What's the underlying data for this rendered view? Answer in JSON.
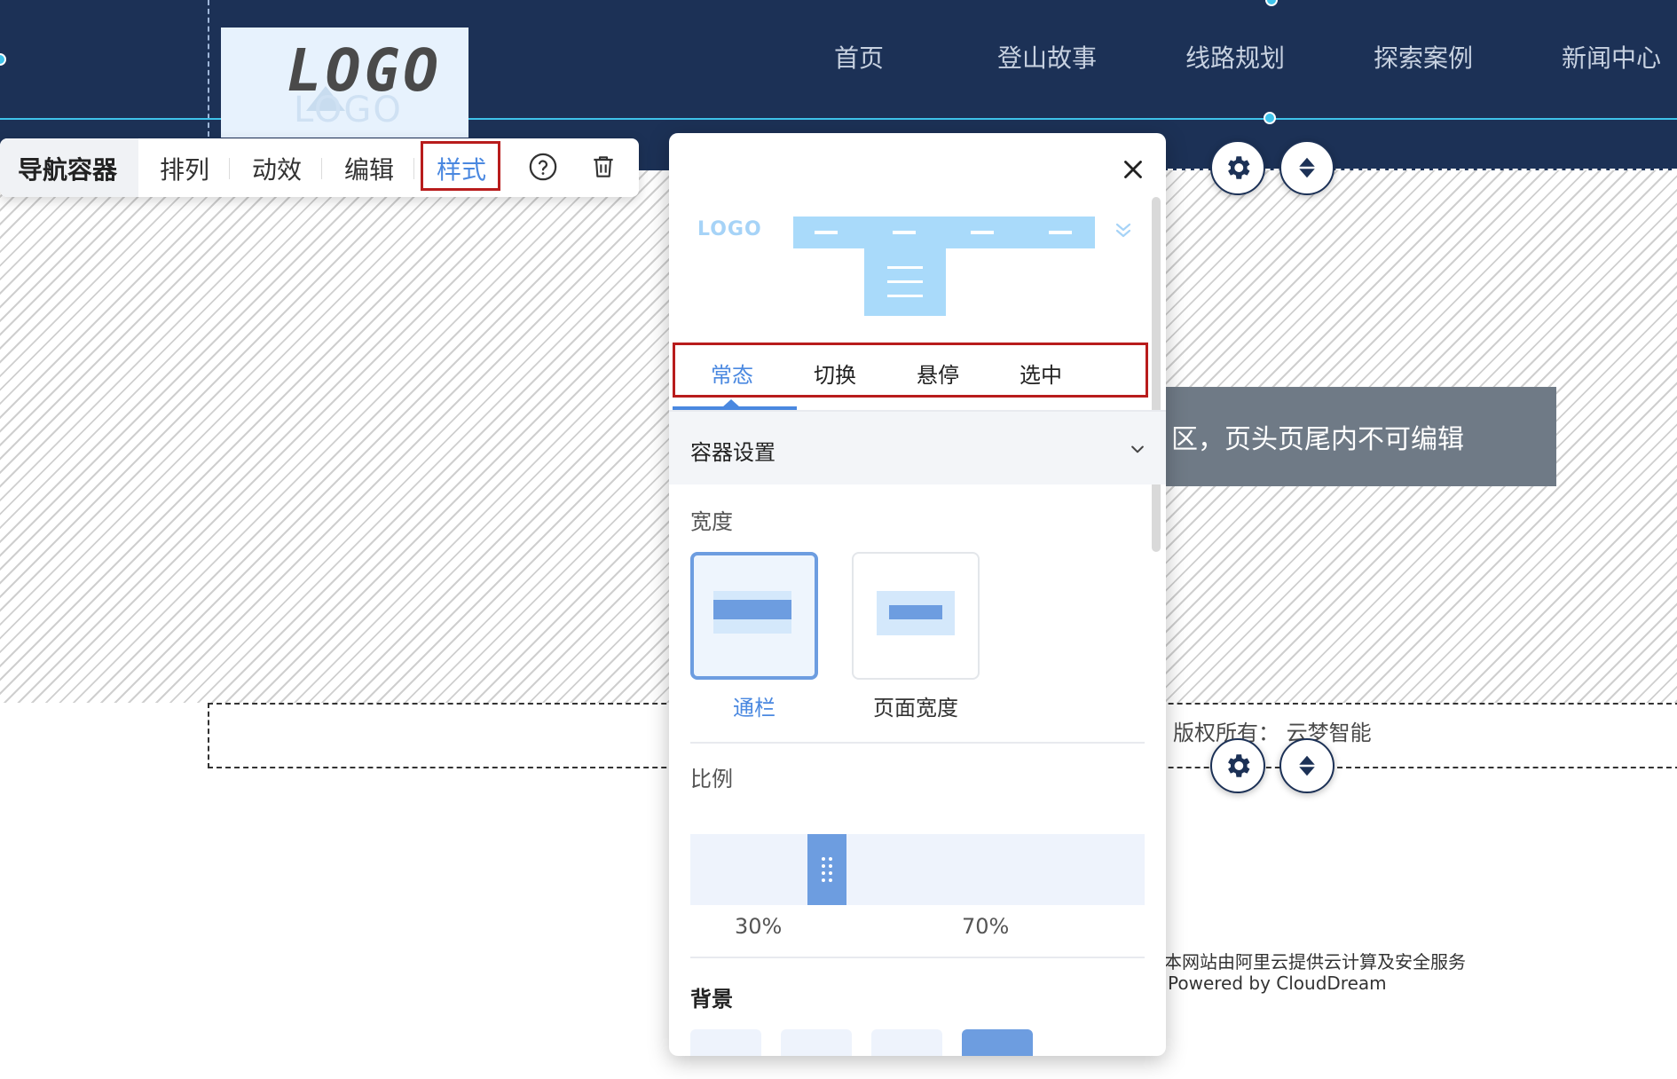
{
  "header": {
    "logo_text": "LOGO",
    "logo_ghost_text": "LOGO",
    "nav": [
      "首页",
      "登山故事",
      "线路规划",
      "探索案例",
      "新闻中心"
    ]
  },
  "canvas": {
    "notice": "区，页头页尾内不可编辑",
    "copyright": "版权所有：  云梦智能",
    "powered_cn": "本网站由阿里云提供云计算及安全服务",
    "powered_en": "Powered by CloudDream"
  },
  "controls": {
    "settings_icon": "gear-icon",
    "move_icon": "up-down-arrows-icon"
  },
  "toolbar": {
    "container_label": "导航容器",
    "arrange_label": "排列",
    "animation_label": "动效",
    "edit_label": "编辑",
    "style_label": "样式",
    "help_icon": "question-circle-icon",
    "delete_icon": "trash-icon"
  },
  "panel": {
    "close_icon": "close-icon",
    "preview": {
      "logo_text": "LOGO",
      "expand_icon": "double-chevron-down-icon"
    },
    "tabs": [
      {
        "label": "常态",
        "active": true
      },
      {
        "label": "切换",
        "active": false
      },
      {
        "label": "悬停",
        "active": false
      },
      {
        "label": "选中",
        "active": false
      }
    ],
    "section_title": "容器设置",
    "width": {
      "label": "宽度",
      "options": [
        {
          "label": "通栏",
          "selected": true
        },
        {
          "label": "页面宽度",
          "selected": false
        }
      ]
    },
    "ratio": {
      "label": "比例",
      "left_percent": "30%",
      "right_percent": "70%",
      "value": 0.3
    },
    "background": {
      "label": "背景"
    }
  },
  "colors": {
    "header_bg": "#1c3156",
    "accent": "#4a88e0",
    "highlight_border": "#b81c1c",
    "guide_line": "#3fc3ea"
  }
}
